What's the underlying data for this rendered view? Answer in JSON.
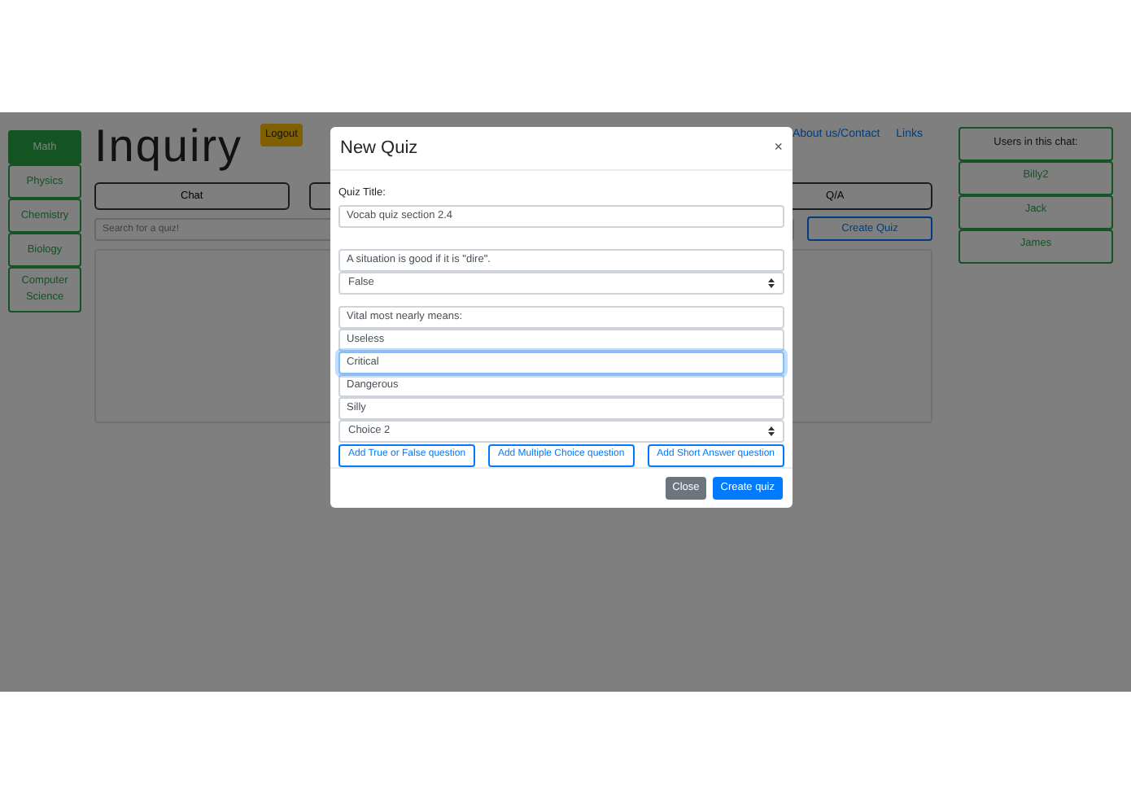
{
  "sidebar": {
    "items": [
      {
        "label": "Math",
        "selected": true
      },
      {
        "label": "Physics",
        "selected": false
      },
      {
        "label": "Chemistry",
        "selected": false
      },
      {
        "label": "Biology",
        "selected": false
      },
      {
        "label": "Computer Science",
        "selected": false
      }
    ]
  },
  "header": {
    "title": "Inquiry",
    "logout": "Logout",
    "links": [
      "About us/Contact",
      "Links"
    ]
  },
  "tabs": [
    {
      "label": "Chat"
    },
    {
      "label": "Q/A"
    }
  ],
  "search": {
    "placeholder": "Search for a quiz!"
  },
  "create_quiz": "Create Quiz",
  "users": {
    "title": "Users in this chat:",
    "items": [
      "Billy2",
      "Jack",
      "James"
    ]
  },
  "modal": {
    "title": "New Quiz",
    "close": "×",
    "quiz_title_label": "Quiz Title:",
    "quiz_title": "Vocab quiz section 2.4",
    "questions": [
      {
        "kind": "true_false",
        "prompt": "A situation is good if it is \"dire\".",
        "answer": "False"
      },
      {
        "kind": "multiple_choice",
        "prompt": "Vital most nearly means:",
        "choices": [
          {
            "value": "Useless",
            "focused": false
          },
          {
            "value": "Critical",
            "focused": true
          },
          {
            "value": "Dangerous",
            "focused": false
          },
          {
            "value": "Silly",
            "focused": false
          }
        ],
        "answer": "Choice 2"
      }
    ],
    "add_buttons": [
      "Add True or False question",
      "Add Multiple Choice question",
      "Add Short Answer question"
    ],
    "footer": {
      "close": "Close",
      "create": "Create quiz"
    }
  }
}
